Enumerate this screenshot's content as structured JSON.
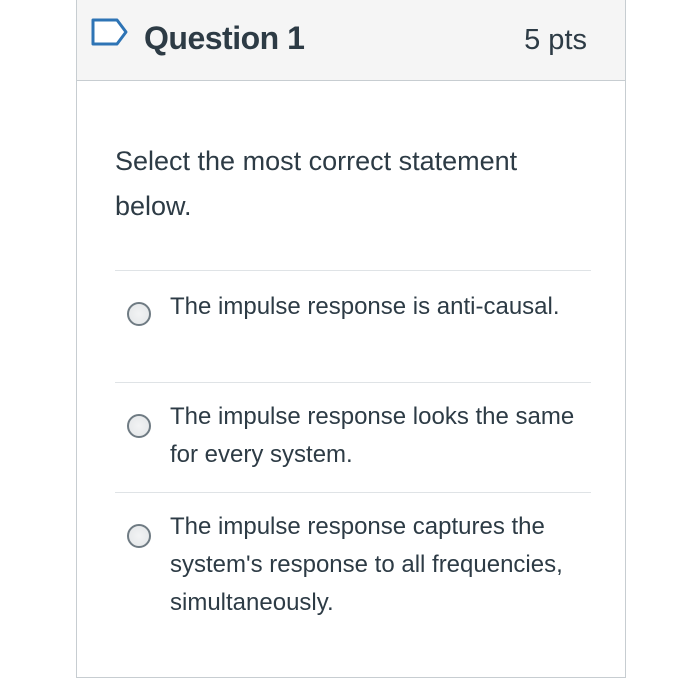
{
  "question": {
    "flag_icon": "flag-icon",
    "title": "Question 1",
    "points": "5 pts",
    "prompt": "Select the most correct statement below.",
    "answers": [
      {
        "label": "The impulse response is anti-causal."
      },
      {
        "label": "The impulse response looks the same for every system."
      },
      {
        "label": "The impulse response captures the system's response to all frequencies, simultaneously."
      }
    ]
  },
  "colors": {
    "text": "#2d3b45",
    "header_bg": "#f5f5f5",
    "border": "#c7cdd1",
    "flag_accent": "#2e74b5",
    "radio_border": "#6f7b83"
  }
}
